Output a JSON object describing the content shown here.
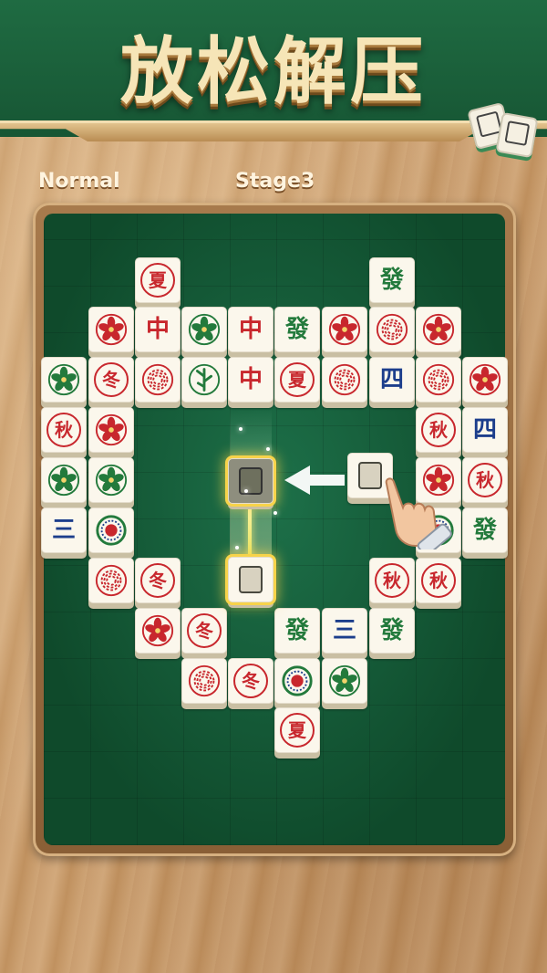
{
  "header": {
    "title": "放松解压"
  },
  "status": {
    "difficulty": "Normal",
    "stage": "Stage3"
  },
  "colors": {
    "red": "#c8272d",
    "green": "#237a3c",
    "blue": "#1c3e8c",
    "felt": "#145c37",
    "highlight": "#f7d34a"
  },
  "tiles": [
    {
      "label": "夏",
      "kind": "season-circle",
      "color": "red"
    },
    {
      "label": "發",
      "kind": "text",
      "color": "green"
    },
    {
      "label": "",
      "kind": "flower-red",
      "color": "red"
    },
    {
      "label": "中",
      "kind": "text",
      "color": "red"
    },
    {
      "label": "",
      "kind": "flower-green",
      "color": "green"
    },
    {
      "label": "中",
      "kind": "text",
      "color": "red"
    },
    {
      "label": "發",
      "kind": "text",
      "color": "green"
    },
    {
      "label": "",
      "kind": "flower-red",
      "color": "red"
    },
    {
      "label": "",
      "kind": "chrysanthemum",
      "color": "red"
    },
    {
      "label": "",
      "kind": "flower-red",
      "color": "red"
    },
    {
      "label": "",
      "kind": "flower-green",
      "color": "green"
    },
    {
      "label": "冬",
      "kind": "season-circle",
      "color": "red"
    },
    {
      "label": "",
      "kind": "chrysanthemum",
      "color": "red"
    },
    {
      "label": "",
      "kind": "bamboo",
      "color": "green"
    },
    {
      "label": "中",
      "kind": "text",
      "color": "red"
    },
    {
      "label": "夏",
      "kind": "season-circle",
      "color": "red"
    },
    {
      "label": "",
      "kind": "chrysanthemum",
      "color": "red"
    },
    {
      "label": "四",
      "kind": "text",
      "color": "blue"
    },
    {
      "label": "",
      "kind": "chrysanthemum",
      "color": "red"
    },
    {
      "label": "",
      "kind": "flower-red",
      "color": "red"
    },
    {
      "label": "秋",
      "kind": "season-circle",
      "color": "red"
    },
    {
      "label": "",
      "kind": "flower-red",
      "color": "red"
    },
    {
      "label": "秋",
      "kind": "season-circle",
      "color": "red"
    },
    {
      "label": "四",
      "kind": "text",
      "color": "blue"
    },
    {
      "label": "",
      "kind": "flower-green",
      "color": "green"
    },
    {
      "label": "",
      "kind": "flower-green",
      "color": "green"
    },
    {
      "label": "",
      "kind": "flower-red",
      "color": "red"
    },
    {
      "label": "秋",
      "kind": "season-circle",
      "color": "red"
    },
    {
      "label": "三",
      "kind": "text",
      "color": "blue"
    },
    {
      "label": "",
      "kind": "dot",
      "color": "red"
    },
    {
      "label": "",
      "kind": "dot",
      "color": "red"
    },
    {
      "label": "發",
      "kind": "text",
      "color": "green"
    },
    {
      "label": "",
      "kind": "chrysanthemum",
      "color": "red"
    },
    {
      "label": "冬",
      "kind": "season-circle",
      "color": "red"
    },
    {
      "label": "秋",
      "kind": "season-circle",
      "color": "red"
    },
    {
      "label": "秋",
      "kind": "season-circle",
      "color": "red"
    },
    {
      "label": "",
      "kind": "flower-red",
      "color": "red"
    },
    {
      "label": "冬",
      "kind": "season-circle",
      "color": "red"
    },
    {
      "label": "發",
      "kind": "text",
      "color": "green"
    },
    {
      "label": "三",
      "kind": "text",
      "color": "blue"
    },
    {
      "label": "發",
      "kind": "text",
      "color": "green"
    },
    {
      "label": "",
      "kind": "chrysanthemum",
      "color": "red"
    },
    {
      "label": "冬",
      "kind": "season-circle",
      "color": "red"
    },
    {
      "label": "",
      "kind": "dot",
      "color": "red"
    },
    {
      "label": "",
      "kind": "flower-green",
      "color": "green"
    },
    {
      "label": "夏",
      "kind": "season-circle",
      "color": "red"
    }
  ],
  "tutorial": {
    "selected_kind": "blank",
    "target_kind": "blank",
    "moving_kind": "blank"
  }
}
